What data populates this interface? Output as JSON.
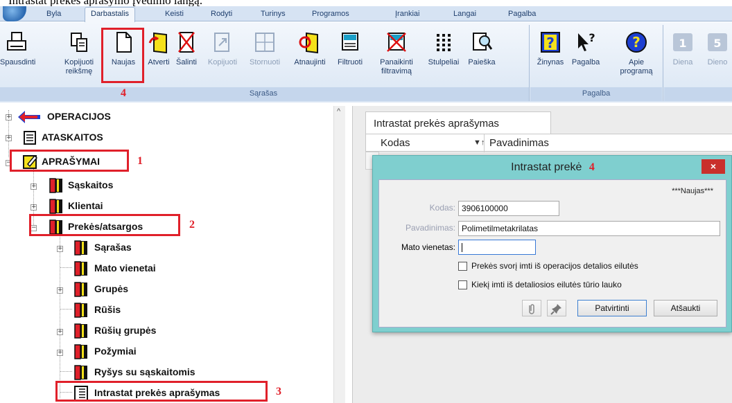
{
  "caption": "Intrastat prekės aprašymo įvedimo langą:",
  "ribbon": {
    "tabs": [
      "Byla",
      "Darbastalis",
      "Keisti",
      "Rodyti",
      "Turinys",
      "Programos",
      "Įrankiai",
      "Langai",
      "Pagalba"
    ],
    "active_tab": "Darbastalis",
    "buttons": [
      {
        "label": "Spausdinti",
        "icon": "printer-icon",
        "enabled": true
      },
      {
        "label": "Kopijuoti\nreikšmę",
        "icon": "copy-value-icon",
        "enabled": true
      },
      {
        "label": "Naujas",
        "icon": "new-document-icon",
        "enabled": true
      },
      {
        "label": "Atverti",
        "icon": "open-icon",
        "enabled": true
      },
      {
        "label": "Šalinti",
        "icon": "delete-icon",
        "enabled": true
      },
      {
        "label": "Kopijuoti",
        "icon": "copy-icon",
        "enabled": false
      },
      {
        "label": "Stornuoti",
        "icon": "storno-icon",
        "enabled": false
      },
      {
        "label": "Atnaujinti",
        "icon": "refresh-icon",
        "enabled": true
      },
      {
        "label": "Filtruoti",
        "icon": "filter-icon",
        "enabled": true
      },
      {
        "label": "Panaikinti\nfiltravimą",
        "icon": "clear-filter-icon",
        "enabled": true
      },
      {
        "label": "Stulpeliai",
        "icon": "columns-icon",
        "enabled": true
      },
      {
        "label": "Paieška",
        "icon": "search-icon",
        "enabled": true
      },
      {
        "label": "Žinynas",
        "icon": "help-book-icon",
        "enabled": true
      },
      {
        "label": "Pagalba",
        "icon": "help-pointer-icon",
        "enabled": true
      },
      {
        "label": "Apie\nprogramą",
        "icon": "about-icon",
        "enabled": true
      },
      {
        "label": "Diena",
        "icon": "day-icon",
        "enabled": false
      },
      {
        "label": "Dieno",
        "icon": "days-icon",
        "enabled": false
      }
    ],
    "groups": {
      "sarasas": "Sąrašas",
      "pagalba": "Pagalba"
    }
  },
  "annotations": {
    "n1": "1",
    "n2": "2",
    "n3": "3",
    "n4": "4",
    "n4b": "4"
  },
  "tree": {
    "nodes": [
      {
        "label": "OPERACIJOS"
      },
      {
        "label": "ATASKAITOS"
      },
      {
        "label": "APRAŠYMAI"
      },
      {
        "label": "Sąskaitos"
      },
      {
        "label": "Klientai"
      },
      {
        "label": "Prekės/atsargos"
      },
      {
        "label": "Sąrašas"
      },
      {
        "label": "Mato vienetai"
      },
      {
        "label": "Grupės"
      },
      {
        "label": "Rūšis"
      },
      {
        "label": "Rūšių grupės"
      },
      {
        "label": "Požymiai"
      },
      {
        "label": "Ryšys su sąskaitomis"
      },
      {
        "label": "Intrastat prekės aprašymas"
      }
    ]
  },
  "panel": {
    "tab_title": "Intrastat prekės aprašymas",
    "columns": [
      "Kodas",
      "Pavadinimas"
    ]
  },
  "dialog": {
    "title": "Intrastat prekė",
    "close": "×",
    "new_tag": "***Naujas***",
    "kodas_label": "Kodas:",
    "kodas_value": "3906100000",
    "pavadinimas_label": "Pavadinimas:",
    "pavadinimas_value": "Polimetilmetakrilatas",
    "mato_label": "Mato vienetas:",
    "mato_value": "",
    "chk1": "Prekės svorį imti iš operacijos detalios eilutės",
    "chk2": "Kiekį imti iš detaliosios eilutės tūrio lauko",
    "confirm": "Patvirtinti",
    "cancel": "Atšaukti"
  }
}
